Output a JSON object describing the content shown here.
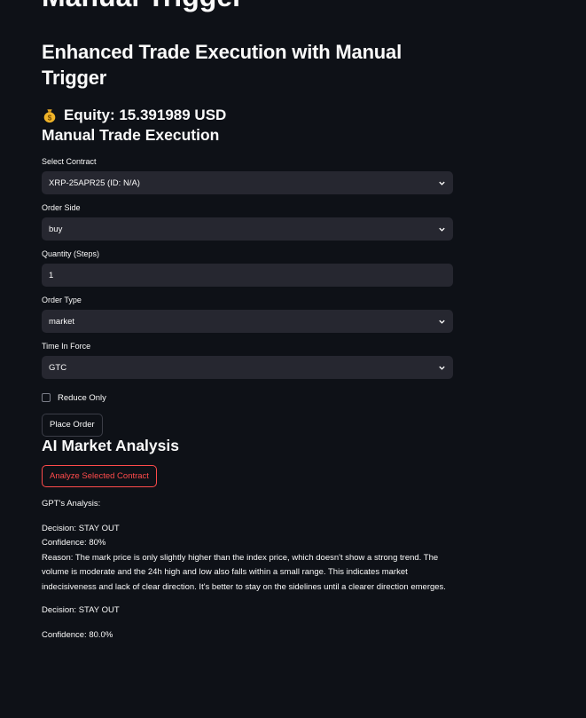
{
  "cut_heading": "Manual Trigger",
  "title": "Enhanced Trade Execution with Manual Trigger",
  "equity": {
    "icon": "money-bag-icon",
    "text": "Equity: 15.391989 USD"
  },
  "manual": {
    "heading": "Manual Trade Execution",
    "contract": {
      "label": "Select Contract",
      "value": "XRP-25APR25 (ID: N/A)"
    },
    "side": {
      "label": "Order Side",
      "value": "buy"
    },
    "quantity": {
      "label": "Quantity (Steps)",
      "value": "1"
    },
    "order_type": {
      "label": "Order Type",
      "value": "market"
    },
    "tif": {
      "label": "Time In Force",
      "value": "GTC"
    },
    "reduce_only": {
      "label": "Reduce Only",
      "checked": false
    },
    "place_order": "Place Order"
  },
  "ai": {
    "heading": "AI Market Analysis",
    "analyze_button": "Analyze Selected Contract",
    "gpt_label": "GPT's Analysis:",
    "decision_line": "Decision: STAY OUT",
    "confidence_line": "Confidence: 80%",
    "reason_line": "Reason: The mark price is only slightly higher than the index price, which doesn't show a strong trend. The volume is moderate and the 24h high and low also falls within a small range. This indicates market indecisiveness and lack of clear direction. It's better to stay on the sidelines until a clearer direction emerges.",
    "decision": "Decision: STAY OUT",
    "confidence": "Confidence: 80.0%"
  },
  "colors": {
    "background": "#0e1117",
    "input_bg": "#262730",
    "accent": "#ff4b4b"
  }
}
